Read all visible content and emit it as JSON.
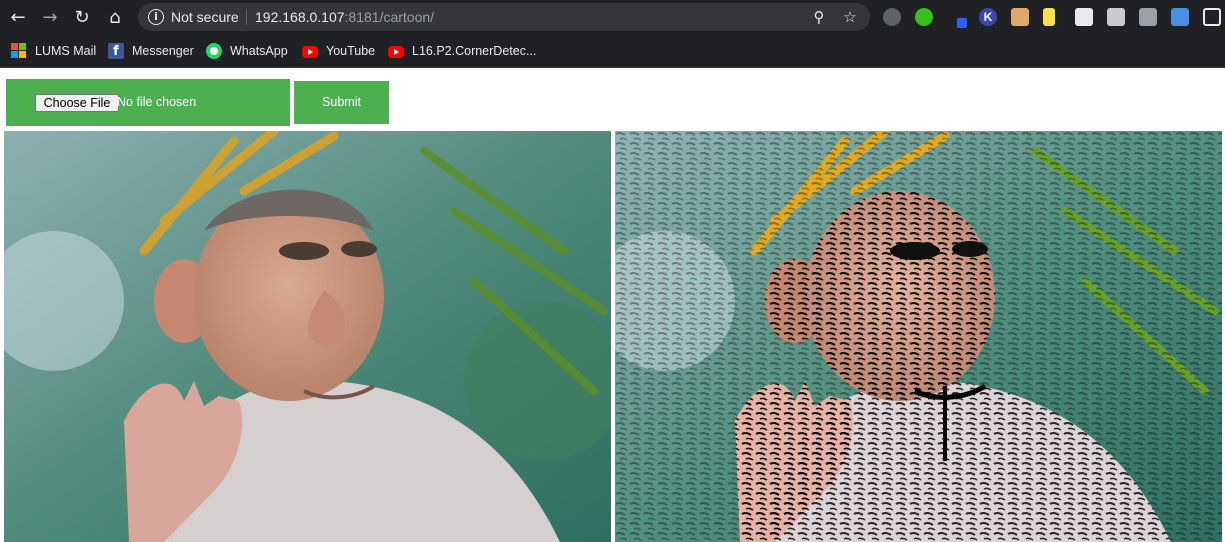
{
  "browser": {
    "security_label": "Not secure",
    "url_host": "192.168.0.107",
    "url_rest": ":8181/cartoon/",
    "colors": {
      "toolbar_bg": "#202124",
      "omnibox_bg": "#35363a",
      "text": "#e8eaed"
    }
  },
  "bookmarks": [
    {
      "label": "LUMS Mail",
      "icon": "microsoft-logo-icon"
    },
    {
      "label": "Messenger",
      "icon": "facebook-icon"
    },
    {
      "label": "WhatsApp",
      "icon": "whatsapp-icon"
    },
    {
      "label": "YouTube",
      "icon": "youtube-icon"
    },
    {
      "label": "L16.P2.CornerDetec...",
      "icon": "youtube-icon"
    }
  ],
  "form": {
    "choose_file_label": "Choose File",
    "file_status": "No file chosen",
    "submit_label": "Submit",
    "accent_color": "#4caf50"
  },
  "images": {
    "original": "photo of a monkey with a raised hand",
    "cartoon": "cartoonized version of the same monkey photo"
  }
}
